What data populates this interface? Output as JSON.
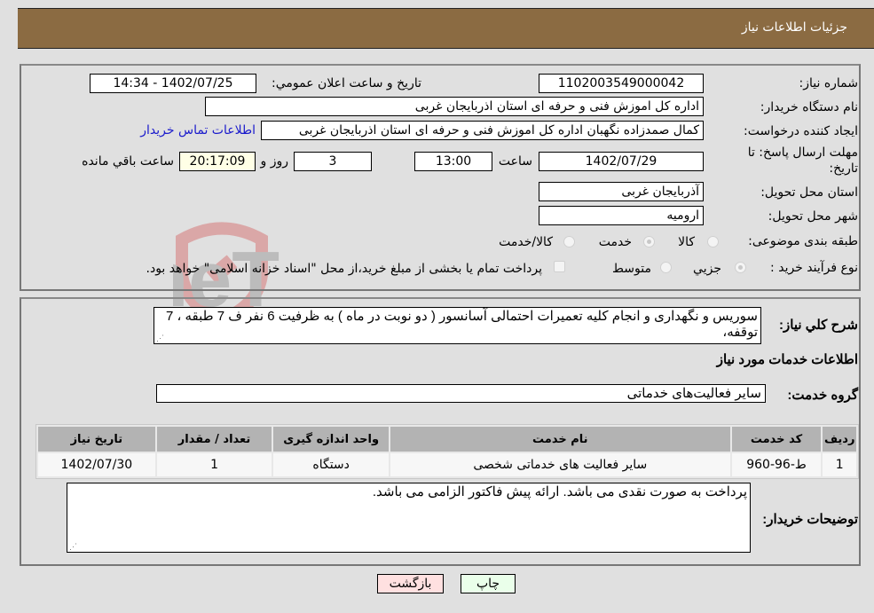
{
  "header": {
    "title": "جزئیات اطلاعات نیاز"
  },
  "fields": {
    "need_number": {
      "label": "شماره نیاز:",
      "value": "1102003549000042"
    },
    "announce_datetime": {
      "label": "تاریخ و ساعت اعلان عمومي:",
      "value": "1402/07/25 - 14:34"
    },
    "buyer_org": {
      "label": "نام دستگاه خریدار:",
      "value": "اداره کل اموزش فنی و حرفه ای استان اذربایجان غربی"
    },
    "requester": {
      "label": "ایجاد کننده درخواست:",
      "value": "کمال صمدزاده نگهبان اداره کل اموزش فنی و حرفه ای استان اذربایجان غربی"
    },
    "contact_link": "اطلاعات تماس خریدار",
    "deadline": {
      "label_line1": "مهلت ارسال پاسخ: تا",
      "label_line2": "تاریخ:",
      "date": "1402/07/29",
      "time_label": "ساعت",
      "time": "13:00",
      "days": "3",
      "days_label": "روز و",
      "remaining": "20:17:09",
      "remaining_label": "ساعت باقي مانده"
    },
    "province": {
      "label": "استان محل تحویل:",
      "value": "آذربایجان غربی"
    },
    "city": {
      "label": "شهر محل تحویل:",
      "value": "ارومیه"
    },
    "category": {
      "label": "طبقه بندی موضوعی:",
      "options": [
        "کالا",
        "خدمت",
        "کالا/خدمت"
      ],
      "selected": "خدمت"
    },
    "purchase_type": {
      "label": "نوع فرآیند خرید :",
      "options": [
        "جزیي",
        "متوسط"
      ],
      "selected": "جزیي",
      "treasury_note": "پرداخت تمام یا بخشی از مبلغ خرید،از محل \"اسناد خزانه اسلامی\" خواهد بود."
    }
  },
  "description": {
    "label": "شرح کلي نیاز:",
    "value": "سوریس و نگهداری و انجام کلیه تعمیرات احتمالی آسانسور ( دو نوبت در ماه ) به ظرفیت 6 نفر ف 7 طبقه ، 7 توقفه،"
  },
  "services_section_title": "اطلاعات خدمات مورد نیاز",
  "service_group": {
    "label": "گروه خدمت:",
    "value": "سایر فعالیت‌های خدماتی"
  },
  "table": {
    "headers": [
      "ردیف",
      "کد خدمت",
      "نام خدمت",
      "واحد اندازه گیری",
      "تعداد / مقدار",
      "تاریخ نیاز"
    ],
    "rows": [
      [
        "1",
        "ط-96-960",
        "سایر فعالیت های خدماتی شخصی",
        "دستگاه",
        "1",
        "1402/07/30"
      ]
    ]
  },
  "buyer_notes": {
    "label": "توضیحات خریدار:",
    "value": "پرداخت به صورت نقدی می باشد. ارائه پیش فاکتور الزامی می باشد."
  },
  "buttons": {
    "print": "چاپ",
    "back": "بازگشت"
  },
  "colors": {
    "header_bg": "#8b6b42",
    "print_bg": "#eaffea",
    "back_bg": "#ffe0e0",
    "link": "#1a1acc"
  },
  "watermark": "AriaTender.neT"
}
